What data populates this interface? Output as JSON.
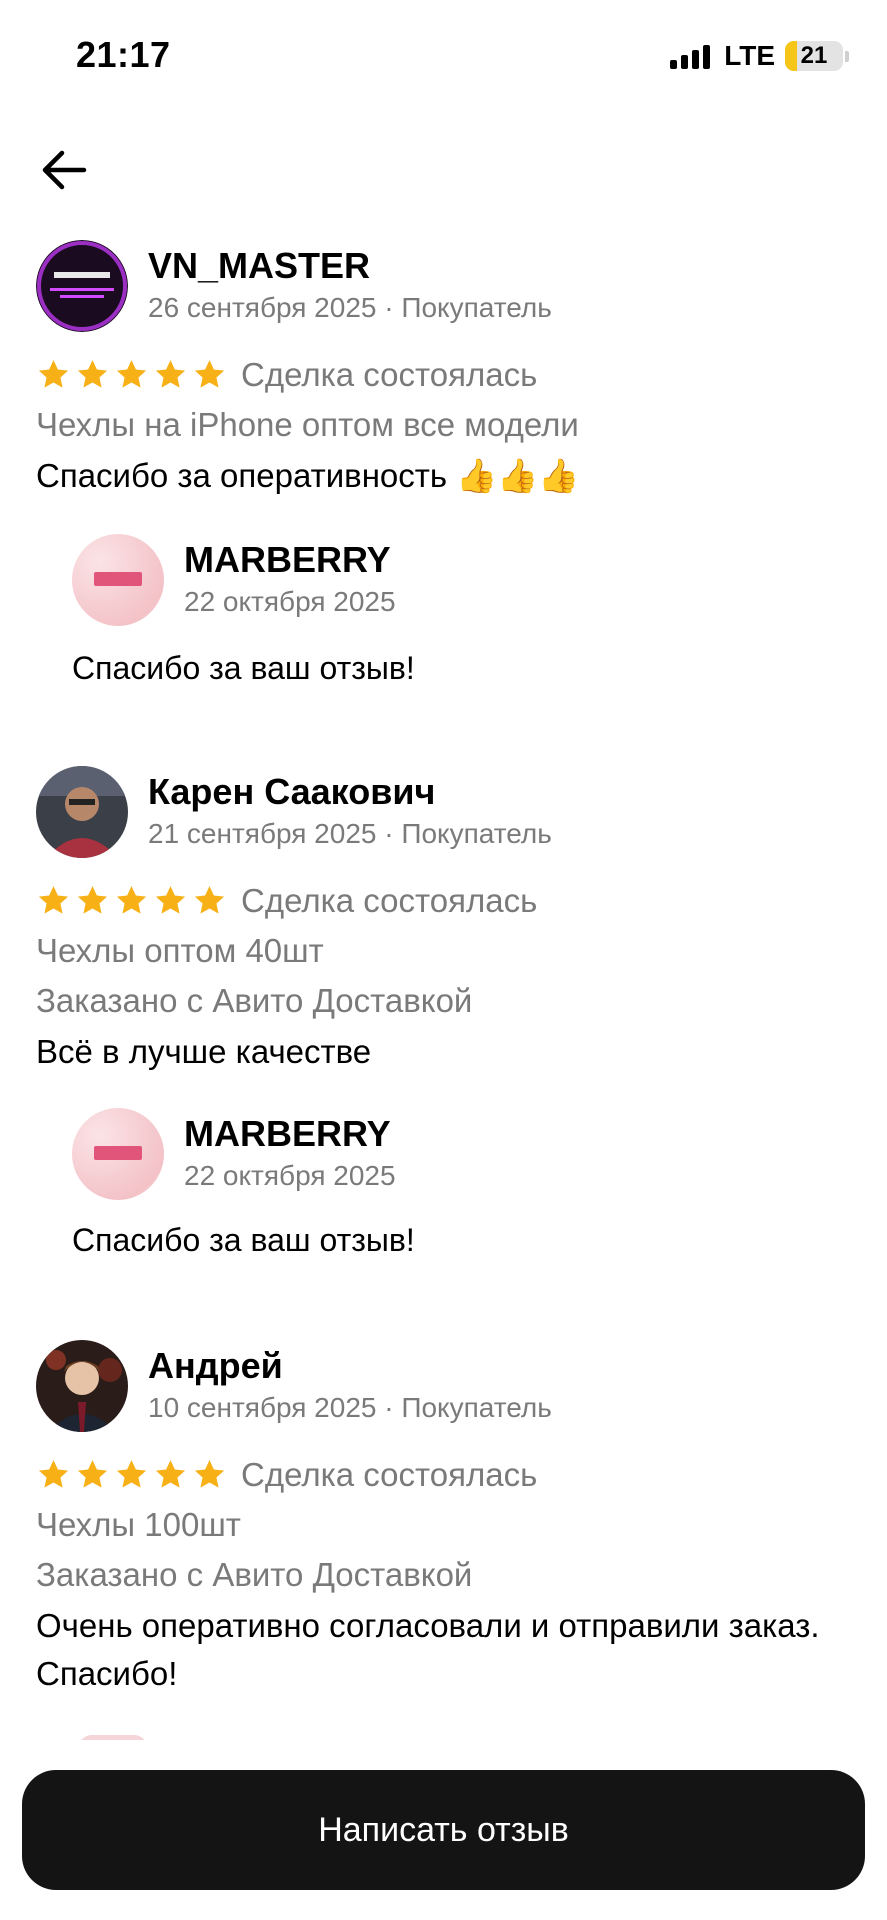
{
  "status_bar": {
    "time": "21:17",
    "network": "LTE",
    "battery_percent": "21",
    "battery_level": 0.21,
    "battery_color": "#f5c518"
  },
  "header": {
    "back_icon": "arrow-left-icon"
  },
  "reviews": [
    {
      "author": "VN_MASTER",
      "meta": "26 сентября 2025 · Покупатель",
      "rating": 5,
      "status": "Сделка состоялась",
      "item": "Чехлы на iPhone оптом все модели",
      "delivery": "",
      "text": "Спасибо за оперативность 👍👍👍",
      "reply": {
        "author": "MARBERRY",
        "date": "22 октября 2025",
        "text": "Спасибо за ваш отзыв!"
      }
    },
    {
      "author": "Карен Саакович",
      "meta": "21 сентября 2025 · Покупатель",
      "rating": 5,
      "status": "Сделка состоялась",
      "item": "Чехлы оптом 40шт",
      "delivery": "Заказано с Авито Доставкой",
      "text": "Всё в лучше качестве",
      "reply": {
        "author": "MARBERRY",
        "date": "22 октября 2025",
        "text": "Спасибо за ваш отзыв!"
      }
    },
    {
      "author": "Андрей",
      "meta": "10 сентября 2025 · Покупатель",
      "rating": 5,
      "status": "Сделка состоялась",
      "item": "Чехлы 100шт",
      "delivery": "Заказано с Авито Доставкой",
      "text": "Очень оперативно согласовали и отправили заказ. Спасибо!"
    }
  ],
  "colors": {
    "star": "#f7b016",
    "muted": "#7a7a7a",
    "button": "#141414"
  },
  "cta": {
    "label": "Написать отзыв"
  }
}
